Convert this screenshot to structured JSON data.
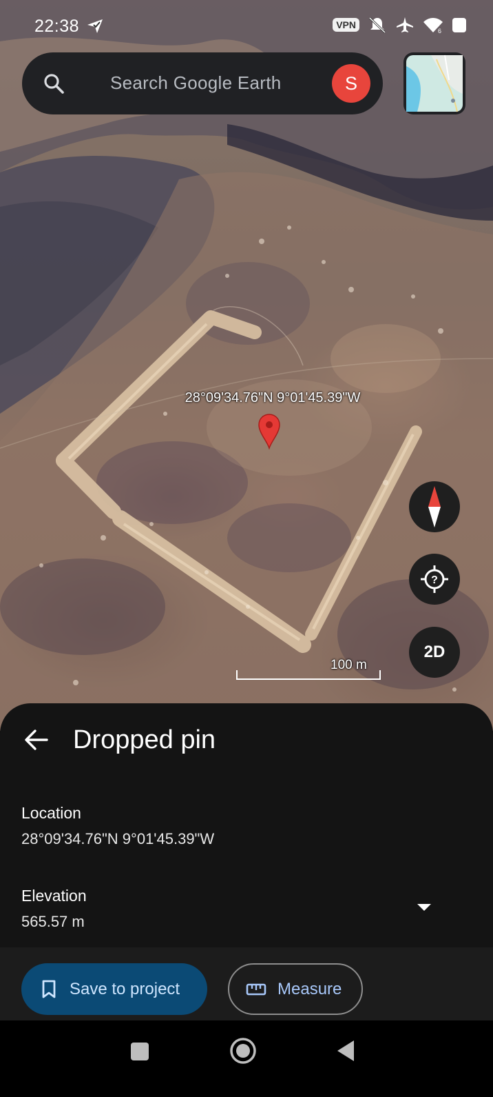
{
  "status_bar": {
    "time": "22:38",
    "vpn": "VPN",
    "icons": [
      "location-check-icon",
      "bell-off-icon",
      "airplane-icon",
      "wifi-icon",
      "battery-icon"
    ]
  },
  "search": {
    "placeholder": "Search Google Earth",
    "avatar_letter": "S"
  },
  "map": {
    "pin_coordinates": "28°09'34.76\"N 9°01'45.39\"W",
    "scale_label": "100 m",
    "view_toggle_label": "2D"
  },
  "sheet": {
    "title": "Dropped pin",
    "location_label": "Location",
    "location_value": "28°09'34.76\"N 9°01'45.39\"W",
    "elevation_label": "Elevation",
    "elevation_value": "565.57 m"
  },
  "actions": {
    "save_label": "Save to project",
    "measure_label": "Measure"
  },
  "colors": {
    "sheet_bg": "#141414",
    "save_button_bg": "#0b4a75",
    "avatar_bg": "#e8453c",
    "pin_red": "#e53935"
  }
}
